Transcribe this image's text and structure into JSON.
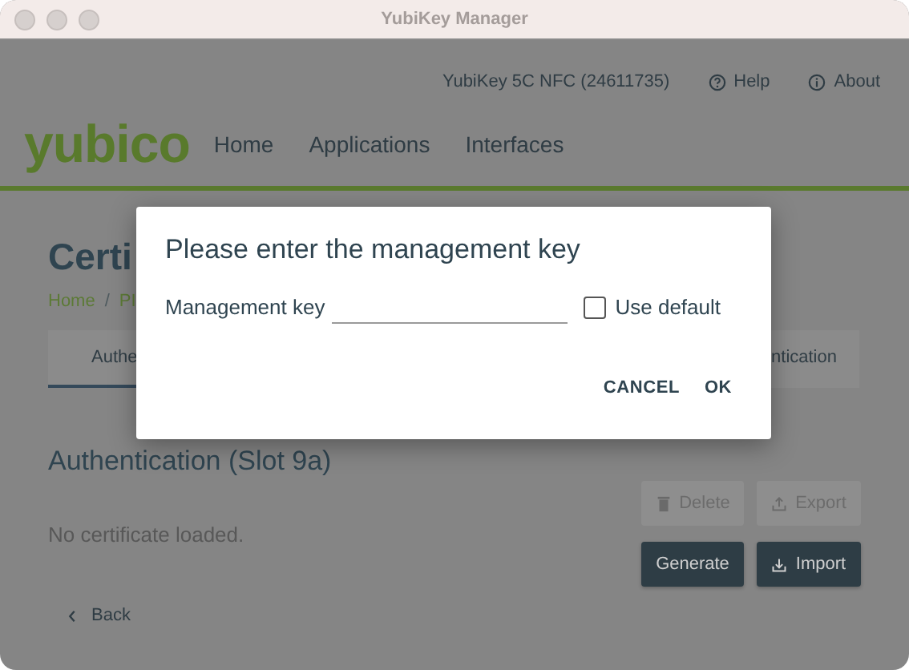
{
  "window": {
    "title": "YubiKey Manager"
  },
  "header": {
    "device": "YubiKey 5C NFC (24611735)",
    "links": [
      {
        "label": "Help",
        "kind": "help"
      },
      {
        "label": "About",
        "kind": "info"
      }
    ]
  },
  "logo": "yubico",
  "nav": [
    "Home",
    "Applications",
    "Interfaces"
  ],
  "page": {
    "title": "Certi",
    "breadcrumb": [
      "Home",
      "/",
      "PI"
    ],
    "tabs": [
      {
        "label": "Authe",
        "selected": true
      },
      {
        "label": "ntication",
        "selected": false
      }
    ],
    "slot_title": "Authentication (Slot 9a)",
    "status": "No certificate loaded.",
    "buttons": [
      {
        "label": "Delete",
        "kind": "delete",
        "disabled": true
      },
      {
        "label": "Export",
        "kind": "export",
        "disabled": true
      },
      {
        "label": "Generate",
        "kind": "generate",
        "disabled": false
      },
      {
        "label": "Import",
        "kind": "import",
        "disabled": false
      }
    ],
    "back": "Back"
  },
  "dialog": {
    "title": "Please enter the management key",
    "field_label": "Management key",
    "checkbox": {
      "label": "Use default",
      "checked": false
    },
    "buttons": [
      "CANCEL",
      "OK"
    ]
  }
}
